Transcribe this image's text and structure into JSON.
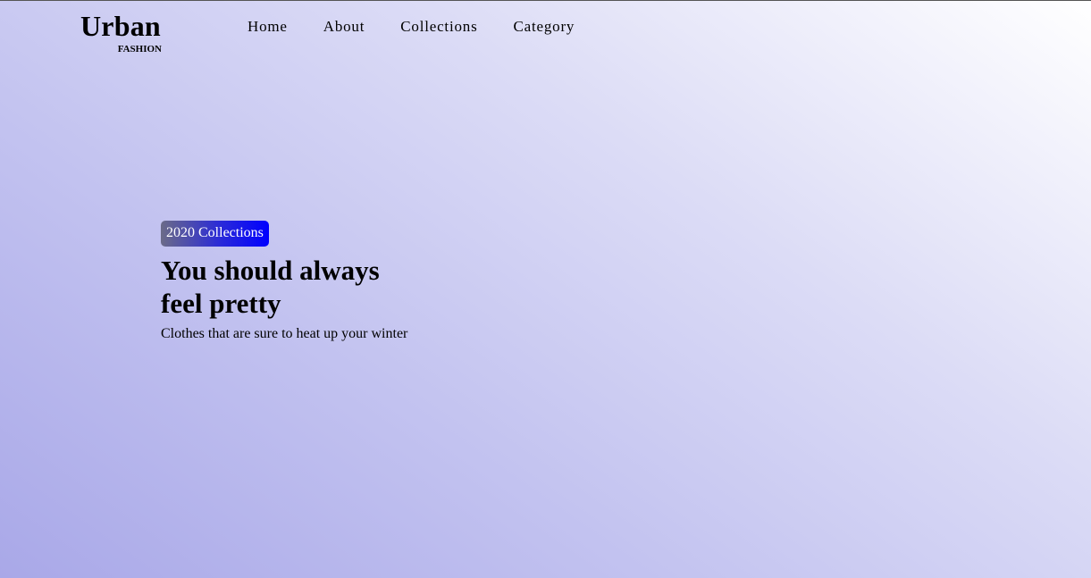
{
  "brand": {
    "name": "Urban",
    "tagline": "FASHION"
  },
  "nav": {
    "items": [
      {
        "label": "Home"
      },
      {
        "label": "About"
      },
      {
        "label": "Collections"
      },
      {
        "label": "Category"
      }
    ]
  },
  "hero": {
    "badge": "2020 Collections",
    "headline": "You should always feel pretty",
    "subline": "Clothes that are sure to heat up your winter"
  },
  "colors": {
    "badge_start": "#6b6b88",
    "badge_end": "#0000ff",
    "background_start": "#a9a8e8",
    "background_end": "#ffffff"
  }
}
